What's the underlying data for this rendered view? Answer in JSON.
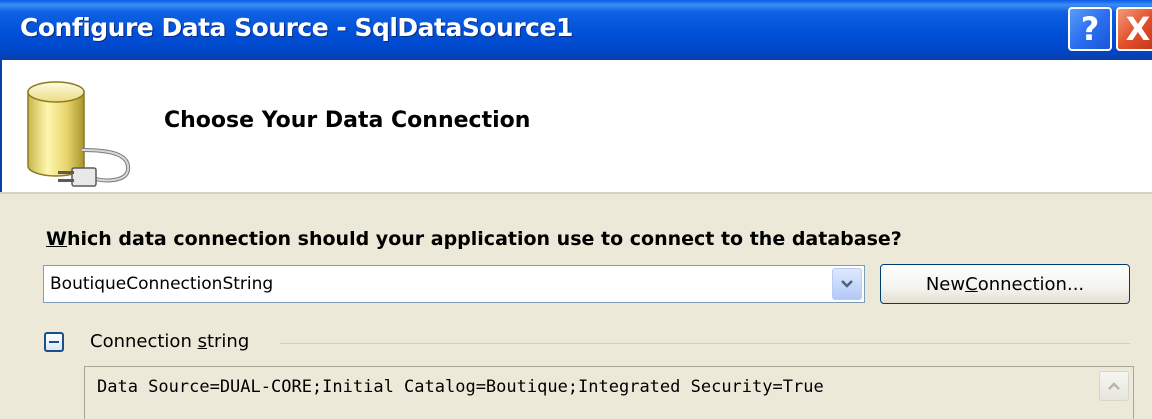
{
  "window": {
    "title": "Configure Data Source - SqlDataSource1",
    "help_label": "?",
    "close_label": "X"
  },
  "header": {
    "title": "Choose Your Data Connection",
    "icon": "database-plug-icon"
  },
  "form": {
    "question_mnemonic": "W",
    "question_rest": "hich data connection should your application use to connect to the database?",
    "connection_combo": {
      "value": "BoutiqueConnectionString",
      "icon": "chevron-down-icon"
    },
    "new_connection_button": {
      "label_pre": "New ",
      "label_mnemonic": "C",
      "label_post": "onnection..."
    },
    "connection_string_section": {
      "label_pre": "Connection ",
      "label_mnemonic": "s",
      "label_post": "tring",
      "value": "Data Source=DUAL-CORE;Initial Catalog=Boutique;Integrated Security=True",
      "icon": "collapse-icon"
    }
  },
  "colors": {
    "titlebar": "#0050d8",
    "dialog_bg": "#ece9d8",
    "header_bg": "#ffffff",
    "close_button": "#e2502a"
  }
}
